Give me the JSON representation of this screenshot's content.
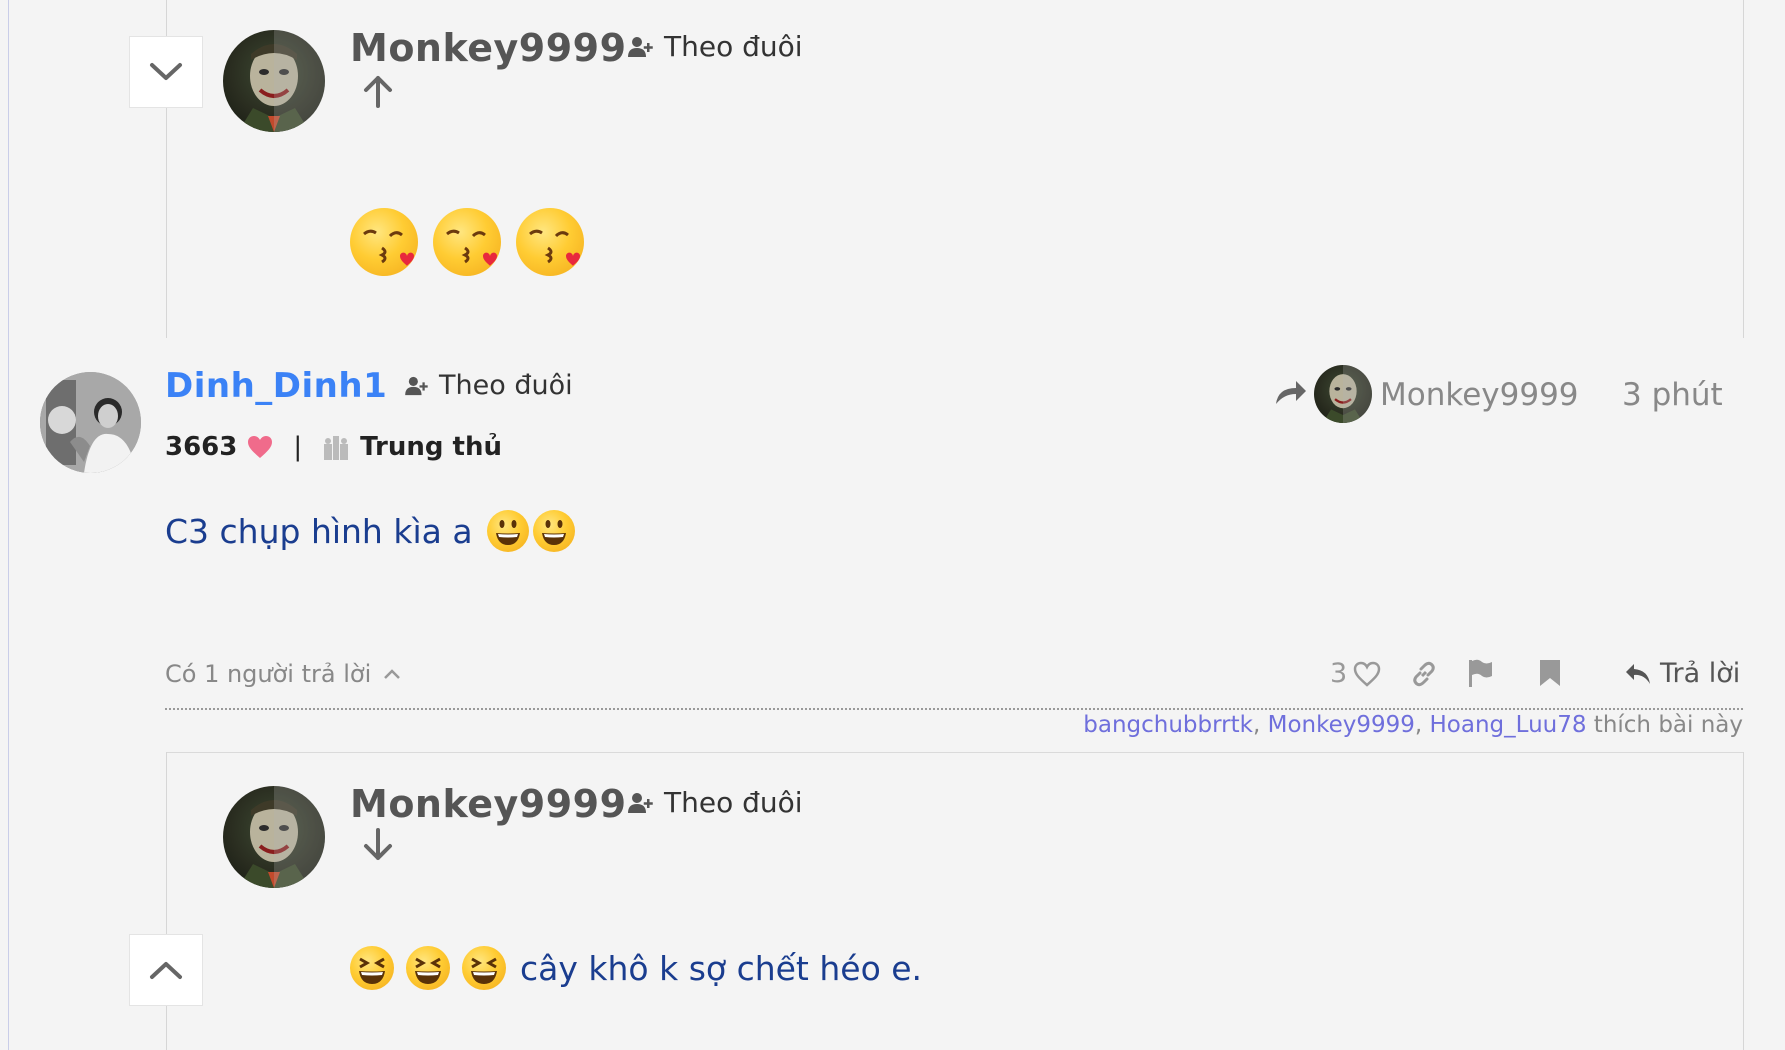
{
  "top_reply": {
    "username": "Monkey9999",
    "follow_label": "Theo đuôi",
    "emojis": [
      "kissing-heart-emoji",
      "kissing-heart-emoji",
      "kissing-heart-emoji"
    ]
  },
  "post": {
    "username": "Dinh_Dinh1",
    "follow_label": "Theo đuôi",
    "reputation": "3663",
    "separator": "|",
    "rank": "Trung thủ",
    "reply_to_user": "Monkey9999",
    "time": "3 phút",
    "content": "C3 chụp hình kìa a",
    "replies_summary": "Có 1 người trả lời",
    "like_count": "3",
    "reply_label": "Trả lời",
    "likers": [
      "bangchubbrrtk",
      "Monkey9999",
      "Hoang_Luu78"
    ],
    "likers_sep": ",",
    "likers_suffix": "thích bài này"
  },
  "bottom_reply": {
    "username": "Monkey9999",
    "follow_label": "Theo đuôi",
    "content": "cây khô k sợ chết héo e."
  },
  "colors": {
    "background": "#f4f4f4",
    "username_blue": "#3b82f6",
    "content_blue": "#1a3d8f",
    "liker_link": "#6f6fdc",
    "heart": "#f06b8b"
  }
}
